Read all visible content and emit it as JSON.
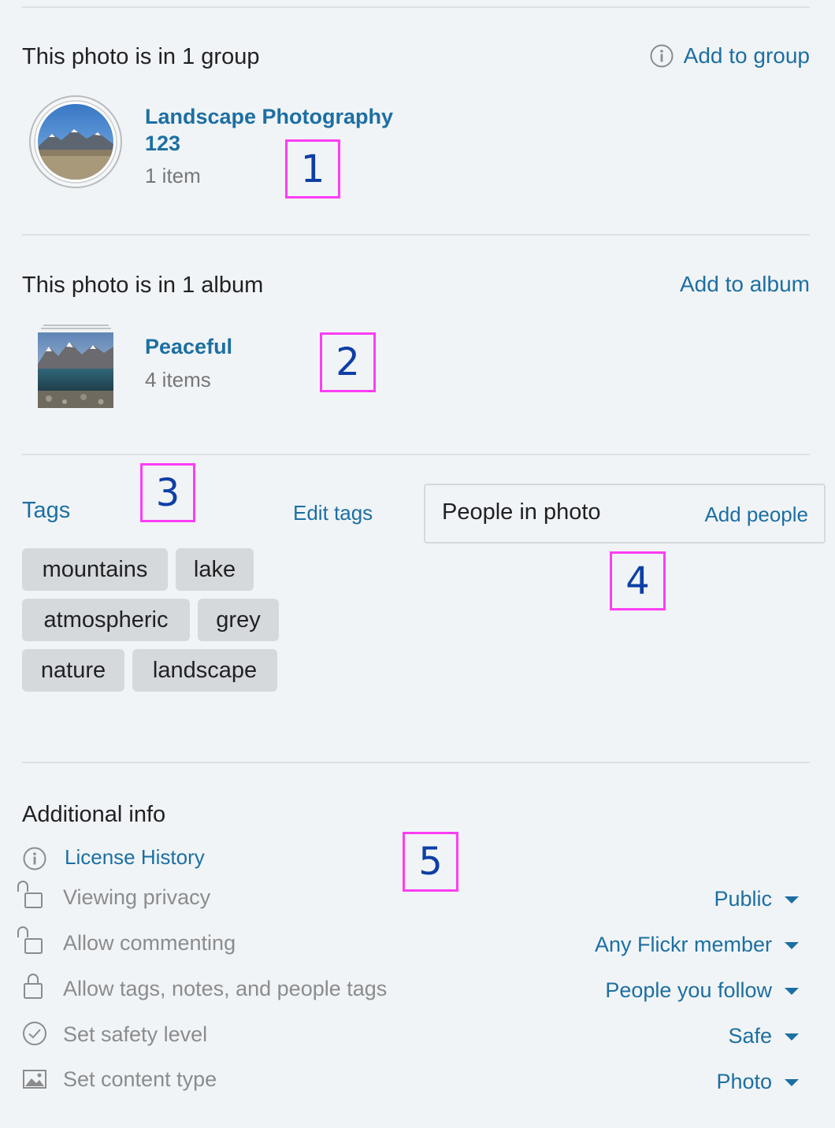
{
  "groups": {
    "heading": "This photo is in 1 group",
    "add_label": "Add to group",
    "items": [
      {
        "name_line1": "Landscape Photography",
        "name_line2": "123",
        "count": "1 item"
      }
    ]
  },
  "albums": {
    "heading": "This photo is in 1 album",
    "add_label": "Add to album",
    "items": [
      {
        "name": "Peaceful",
        "count": "4 items"
      }
    ]
  },
  "tags": {
    "heading": "Tags",
    "edit_label": "Edit tags",
    "items": [
      "mountains",
      "lake",
      "atmospheric",
      "grey",
      "nature",
      "landscape"
    ]
  },
  "people": {
    "heading": "People in photo",
    "add_label": "Add people"
  },
  "additional": {
    "heading": "Additional info",
    "license_link": "License History",
    "rows": [
      {
        "label": "Viewing privacy",
        "value": "Public",
        "icon": "unlock-icon"
      },
      {
        "label": "Allow commenting",
        "value": "Any Flickr member",
        "icon": "unlock-icon"
      },
      {
        "label": "Allow tags, notes, and people tags",
        "value": "People you follow",
        "icon": "lock-icon"
      },
      {
        "label": "Set safety level",
        "value": "Safe",
        "icon": "check-circle-icon"
      },
      {
        "label": "Set content type",
        "value": "Photo",
        "icon": "image-icon"
      }
    ]
  },
  "markers": [
    "1",
    "2",
    "3",
    "4",
    "5"
  ],
  "colors": {
    "link": "#1c6fa3",
    "marker_border": "#ff3df5",
    "marker_text": "#0d3fa5",
    "tag_bg": "#d5d9dc"
  }
}
